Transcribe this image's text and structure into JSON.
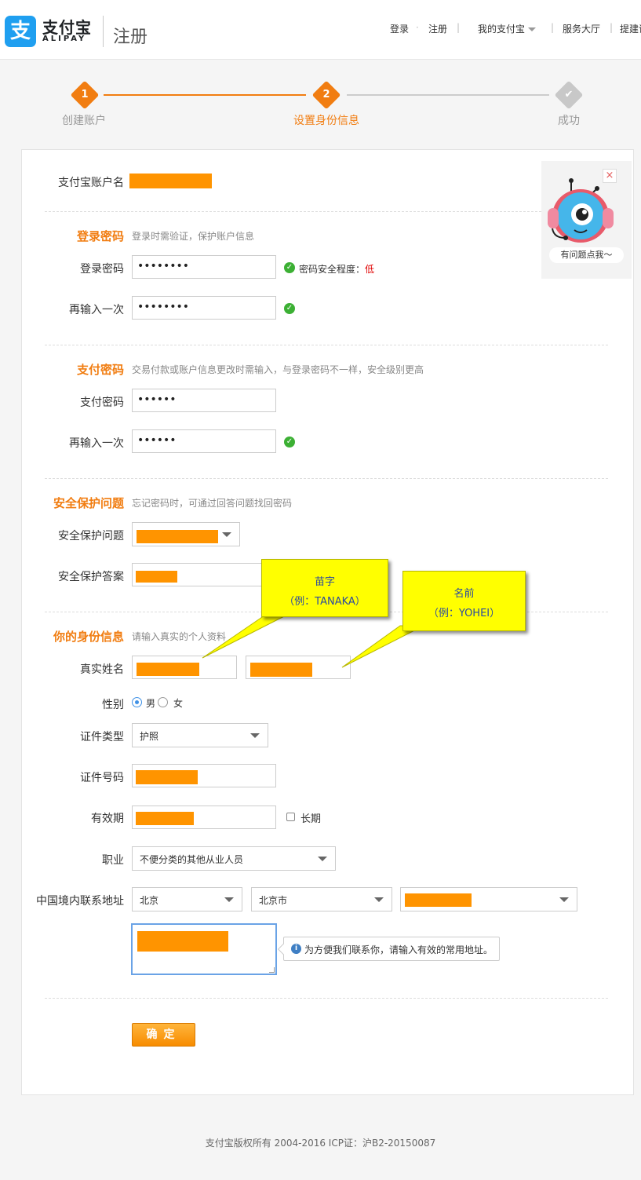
{
  "header": {
    "logo_cn": "支付宝",
    "logo_en": "ALIPAY",
    "logo_glyph": "支",
    "page_title": "注册",
    "nav": {
      "login": "登录",
      "register": "注册",
      "my_alipay": "我的支付宝",
      "service_hall": "服务大厅",
      "suggest": "提建议"
    }
  },
  "progress": {
    "steps": [
      {
        "num": "1",
        "label": "创建账户",
        "state": "done"
      },
      {
        "num": "2",
        "label": "设置身份信息",
        "state": "current"
      },
      {
        "num": "✔",
        "label": "成功",
        "state": "pending"
      }
    ],
    "colors": {
      "active": "#f17d11",
      "pending": "#cccccc",
      "done_label": "#999999"
    }
  },
  "account": {
    "label": "支付宝账户名"
  },
  "login_password": {
    "title": "登录密码",
    "hint": "登录时需验证，保护账户信息",
    "field_label": "登录密码",
    "field_value": "••••••••",
    "strength_label": "密码安全程度：",
    "strength_value": "低",
    "confirm_label": "再输入一次",
    "confirm_value": "••••••••"
  },
  "pay_password": {
    "title": "支付密码",
    "hint": "交易付款或账户信息更改时需输入，与登录密码不一样，安全级别更高",
    "field_label": "支付密码",
    "field_value": "••••••",
    "confirm_label": "再输入一次",
    "confirm_value": "••••••"
  },
  "security": {
    "title": "安全保护问题",
    "hint": "忘记密码时，可通过回答问题找回密码",
    "question_label": "安全保护问题",
    "answer_label": "安全保护答案"
  },
  "identity": {
    "title": "你的身份信息",
    "hint": "请输入真实的个人资料",
    "name_label": "真实姓名",
    "gender_label": "性别",
    "gender_male": "男",
    "gender_female": "女",
    "gender_selected": "男",
    "id_type_label": "证件类型",
    "id_type_value": "护照",
    "id_number_label": "证件号码",
    "validity_label": "有效期",
    "long_term_label": "长期",
    "occupation_label": "职业",
    "occupation_value": "不便分类的其他从业人员",
    "address_label": "中国境内联系地址",
    "province_value": "北京",
    "city_value": "北京市",
    "address_tip": "为方便我们联系你，请输入有效的常用地址。"
  },
  "callouts": {
    "surname": {
      "line1": "苗字",
      "line2": "（例：TANAKA）"
    },
    "given": {
      "line1": "名前",
      "line2": "（例：YOHEI）"
    }
  },
  "robot": {
    "caption": "有问题点我～"
  },
  "confirm_label": "确定",
  "footer": "支付宝版权所有 2004-2016 ICP证：沪B2-20150087"
}
